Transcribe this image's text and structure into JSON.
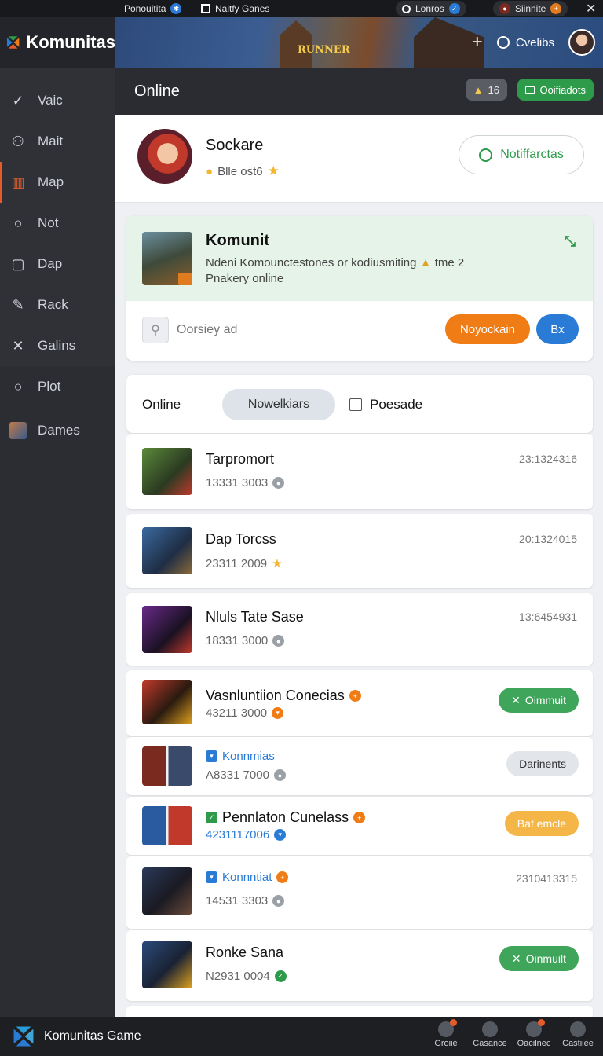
{
  "status_bar": {
    "left_text": "Ponouitita",
    "games_label": "Naitfy Ganes",
    "lonros_label": "Lonros",
    "sinite_label": "Siinnite"
  },
  "header": {
    "app_name": "Komunitas",
    "banner_sign": "RUNNER",
    "add_label": "+",
    "search_label": "Cvelibs"
  },
  "sidebar": {
    "items": [
      {
        "label": "Vaic",
        "icon": "v-icon"
      },
      {
        "label": "Mait",
        "icon": "users-icon"
      },
      {
        "label": "Map",
        "icon": "map-icon"
      },
      {
        "label": "Not",
        "icon": "search-icon"
      },
      {
        "label": "Dap",
        "icon": "doc-icon"
      },
      {
        "label": "Rack",
        "icon": "pen-icon"
      },
      {
        "label": "Galins",
        "icon": "tools-icon"
      },
      {
        "label": "Plot",
        "icon": "search-icon"
      },
      {
        "label": "Dames",
        "icon": "avatar-icon"
      }
    ]
  },
  "title_bar": {
    "title": "Online",
    "badge_count": "16",
    "action_label": "Ooifiadots"
  },
  "profile": {
    "name": "Sockare",
    "subtitle": "Blle ost6",
    "notif_button": "Notiffarctas"
  },
  "komunit": {
    "title": "Komunit",
    "description_line1": "Ndeni Komounctestones or kodiusmiting",
    "description_tail": "tme 2",
    "description_line2": "Pnakery online",
    "search_placeholder": "Oorsiey ad",
    "primary_button": "Noyockain",
    "secondary_button": "Bx"
  },
  "filters": {
    "label": "Online",
    "tab": "Nowelkiars",
    "checkbox_label": "Poesade"
  },
  "rows": [
    {
      "title": "Tarpromort",
      "sub": "13331 3003",
      "right": "23:1324316"
    },
    {
      "title": "Dap Torcss",
      "sub": "23311 2009",
      "right": "20:1324015"
    },
    {
      "title": "Nluls Tate Sase",
      "sub": "18331 3000",
      "right": "13:6454931"
    },
    {
      "title": "Vasnluntiion Conecias",
      "sub": "43211 3000",
      "button": "Oimmuit"
    },
    {
      "title": "Konnmias",
      "sub": "A8331 7000",
      "button": "Darinents"
    },
    {
      "title": "Pennlaton Cunelass",
      "sub": "4231117006",
      "button": "Baf emcle"
    },
    {
      "title": "Konnntiat",
      "sub": "14531 3303",
      "right": "2310413315"
    },
    {
      "title": "Ronke Sana",
      "sub": "N2931 0004",
      "button": "Oinmuilt"
    }
  ],
  "bottom_nav": {
    "brand": "Komunitas Game",
    "items": [
      "Groiie",
      "Casance",
      "Oacilnec",
      "Castiiee"
    ]
  },
  "colors": {
    "accent_orange": "#f07c16",
    "accent_green": "#2e9b4a",
    "accent_blue": "#2a7bd6",
    "sidebar_bg": "#2b2d33"
  }
}
